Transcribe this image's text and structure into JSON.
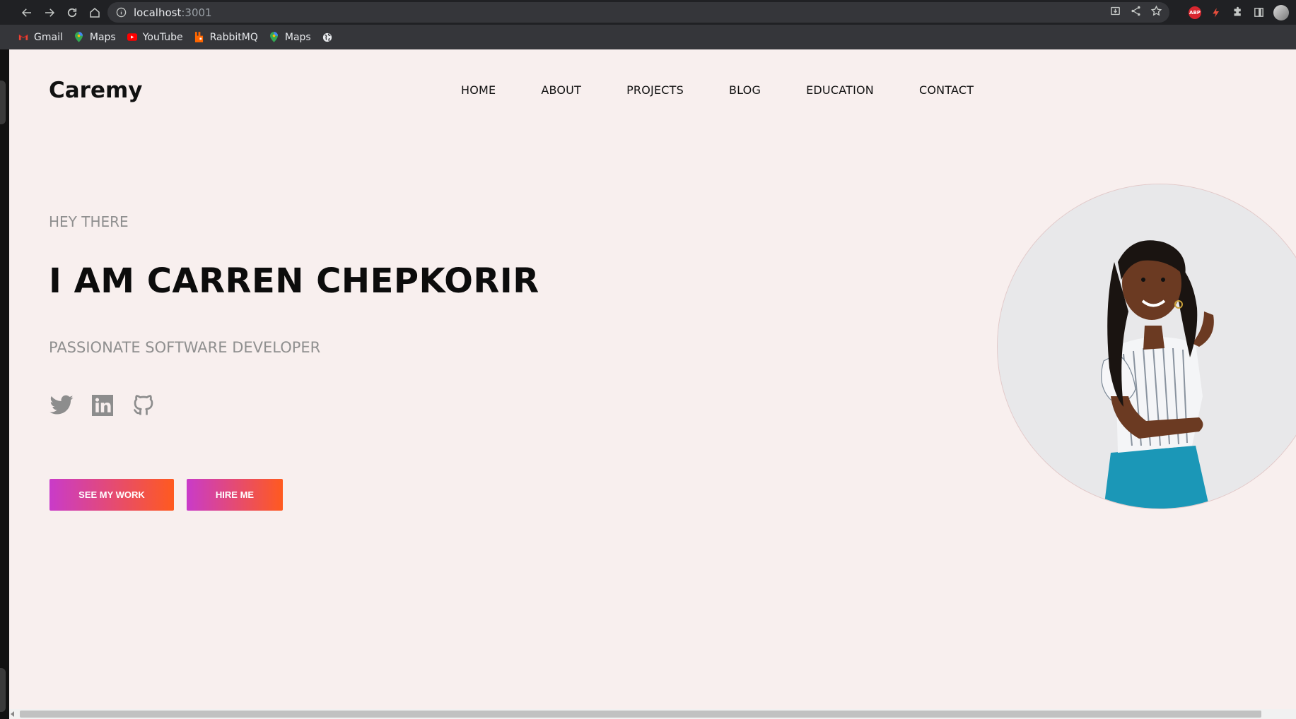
{
  "browser": {
    "url_host": "localhost",
    "url_port": ":3001",
    "extension_abp": "ABP"
  },
  "bookmarks": [
    {
      "label": "Gmail",
      "icon": "gmail-icon"
    },
    {
      "label": "Maps",
      "icon": "maps-icon"
    },
    {
      "label": "YouTube",
      "icon": "youtube-icon"
    },
    {
      "label": "RabbitMQ",
      "icon": "rabbitmq-icon"
    },
    {
      "label": "Maps",
      "icon": "maps-icon"
    },
    {
      "label": "",
      "icon": "globe-icon"
    }
  ],
  "site": {
    "logo": "Caremy",
    "nav": [
      "HOME",
      "ABOUT",
      "PROJECTS",
      "BLOG",
      "EDUCATION",
      "CONTACT"
    ]
  },
  "hero": {
    "greeting": "HEY THERE",
    "headline": "I AM CARREN CHEPKORIR",
    "subtitle": "PASSIONATE SOFTWARE DEVELOPER",
    "socials": [
      "twitter-icon",
      "linkedin-icon",
      "github-icon"
    ],
    "primary_button": "SEE MY WORK",
    "secondary_button": "HIRE ME"
  },
  "colors": {
    "page_bg": "#f8efee",
    "button_gradient_start": "#c93bc9",
    "button_gradient_end": "#ff5a1f",
    "muted_text": "#8f8f8f"
  }
}
